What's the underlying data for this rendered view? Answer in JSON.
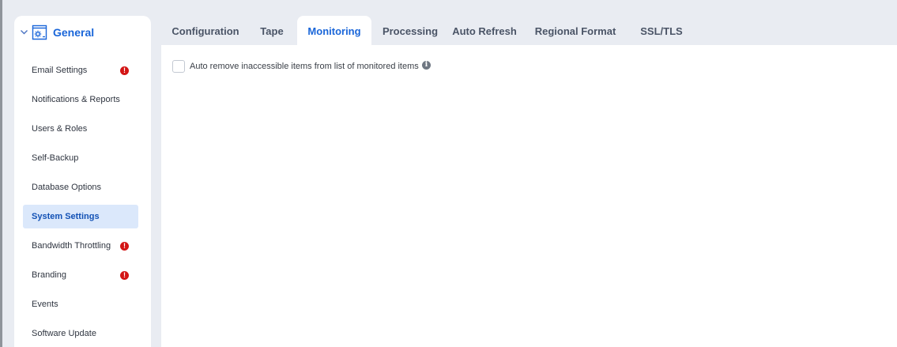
{
  "sidebar": {
    "section_title": "General",
    "section_icon": "gear-screen-icon",
    "expand_icon": "chevron-down-icon",
    "items": [
      {
        "label": "Email Settings",
        "warning": true
      },
      {
        "label": "Notifications & Reports",
        "warning": false
      },
      {
        "label": "Users & Roles",
        "warning": false
      },
      {
        "label": "Self-Backup",
        "warning": false
      },
      {
        "label": "Database Options",
        "warning": false
      },
      {
        "label": "System Settings",
        "warning": false,
        "active": true
      },
      {
        "label": "Bandwidth Throttling",
        "warning": true
      },
      {
        "label": "Branding",
        "warning": true
      },
      {
        "label": "Events",
        "warning": false
      },
      {
        "label": "Software Update",
        "warning": false
      }
    ],
    "warning_glyph": "!",
    "warning_color": "#d31515"
  },
  "tabs": [
    {
      "label": "Configuration"
    },
    {
      "label": "Tape"
    },
    {
      "label": "Monitoring",
      "active": true
    },
    {
      "label": "Processing"
    },
    {
      "label": "Auto Refresh"
    },
    {
      "label": "Regional Format"
    },
    {
      "label": "SSL/TLS"
    }
  ],
  "monitoring": {
    "auto_remove_label": "Auto remove inaccessible items from list of monitored items",
    "auto_remove_checked": false,
    "info_glyph": "i"
  },
  "colors": {
    "accent": "#1a66d9",
    "active_item_bg": "#dbe8fb",
    "background": "#e9ecf2"
  }
}
